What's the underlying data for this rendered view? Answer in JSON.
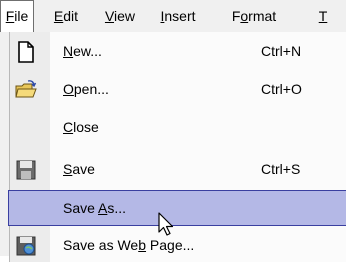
{
  "menubar": {
    "items": [
      {
        "label": "File",
        "access": "F",
        "rest": "ile"
      },
      {
        "label": "Edit",
        "access": "E",
        "rest": "dit"
      },
      {
        "label": "View",
        "access": "V",
        "rest": "iew"
      },
      {
        "label": "Insert",
        "access": "I",
        "rest": "nsert"
      },
      {
        "label": "Format",
        "pre": "F",
        "access": "o",
        "rest": "rmat"
      },
      {
        "label": "T",
        "access": "T",
        "rest": ""
      }
    ]
  },
  "file_menu": {
    "items": [
      {
        "pre": "",
        "access": "N",
        "rest": "ew...",
        "shortcut": "Ctrl+N",
        "icon": "new-document-icon"
      },
      {
        "pre": "",
        "access": "O",
        "rest": "pen...",
        "shortcut": "Ctrl+O",
        "icon": "open-folder-icon"
      },
      {
        "pre": "",
        "access": "C",
        "rest": "lose",
        "shortcut": "",
        "icon": ""
      },
      {
        "pre": "",
        "access": "S",
        "rest": "ave",
        "shortcut": "Ctrl+S",
        "icon": "save-icon"
      },
      {
        "pre": "Save ",
        "access": "A",
        "rest": "s...",
        "shortcut": "",
        "icon": ""
      },
      {
        "pre": "Save as We",
        "access": "b",
        "rest": " Page...",
        "shortcut": "",
        "icon": "web-page-icon"
      }
    ]
  },
  "colors": {
    "highlight": "#b4b8e6",
    "highlight_border": "#3a3fa0"
  }
}
